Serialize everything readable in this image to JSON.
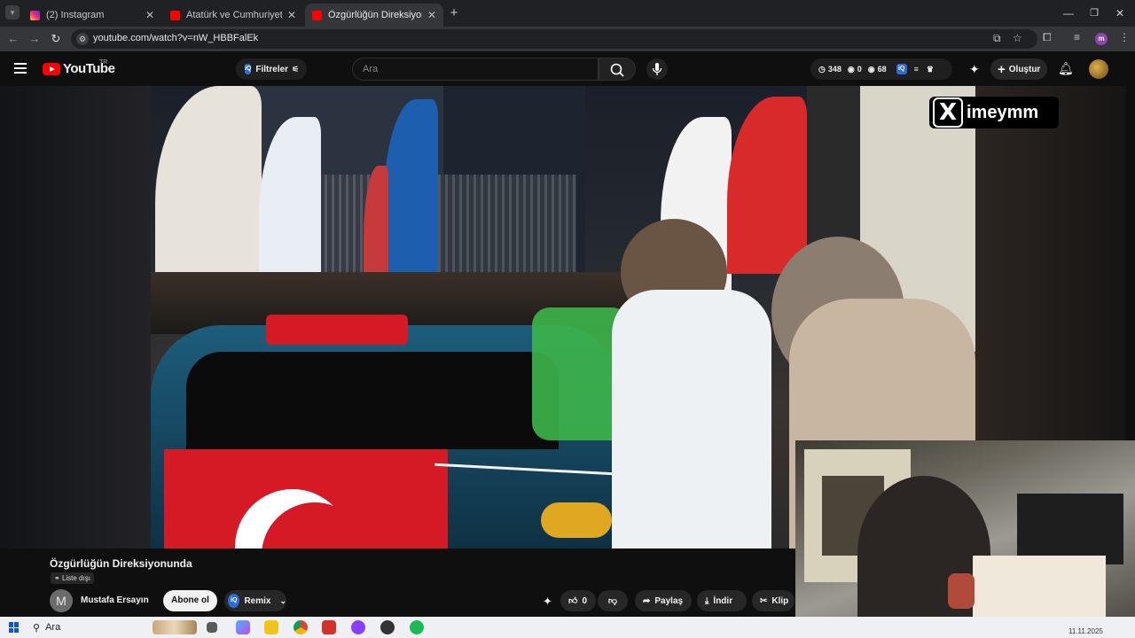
{
  "browser": {
    "tabs": [
      {
        "title": "(2) Instagram",
        "active": false,
        "favicon_color": "#e1306c"
      },
      {
        "title": "Atatürk ve Cumhuriyet - Belge",
        "active": false,
        "favicon_color": "#ff0000"
      },
      {
        "title": "Özgürlüğün Direksiyonunda - Y",
        "active": true,
        "favicon_color": "#ff0000"
      }
    ],
    "new_tab": "+",
    "url": "youtube.com/watch?v=nW_HBBFalEk",
    "profile_initial": "m"
  },
  "youtube": {
    "logo_text": "YouTube",
    "country": "TR",
    "filter_label": "Filtreler",
    "filter_badge": "iQ",
    "search_placeholder": "Ara",
    "stats": {
      "views": "348",
      "likes": "0",
      "subs": "68",
      "badge": "iQ"
    },
    "create_label": "Oluştur"
  },
  "video": {
    "overlay_brand": "imeymm",
    "overlay_logo": "X"
  },
  "below_player": {
    "title": "Özgürlüğün Direksiyonunda",
    "visibility_badge": "Liste dışı",
    "channel_initial": "M",
    "channel_name": "Mustafa Ersayın",
    "subscribe_label": "Abone ol",
    "remix_label": "Remix",
    "remix_badge": "iQ",
    "like_count": "0",
    "share_label": "Paylaş",
    "download_label": "İndir",
    "clip_label": "Klip"
  },
  "taskbar": {
    "search_label": "Ara",
    "date": "11.11.2025"
  },
  "colors": {
    "youtube_red": "#ff0000",
    "turkish_flag_red": "#d61a25",
    "taskbar_bg": "#eef0f4"
  }
}
